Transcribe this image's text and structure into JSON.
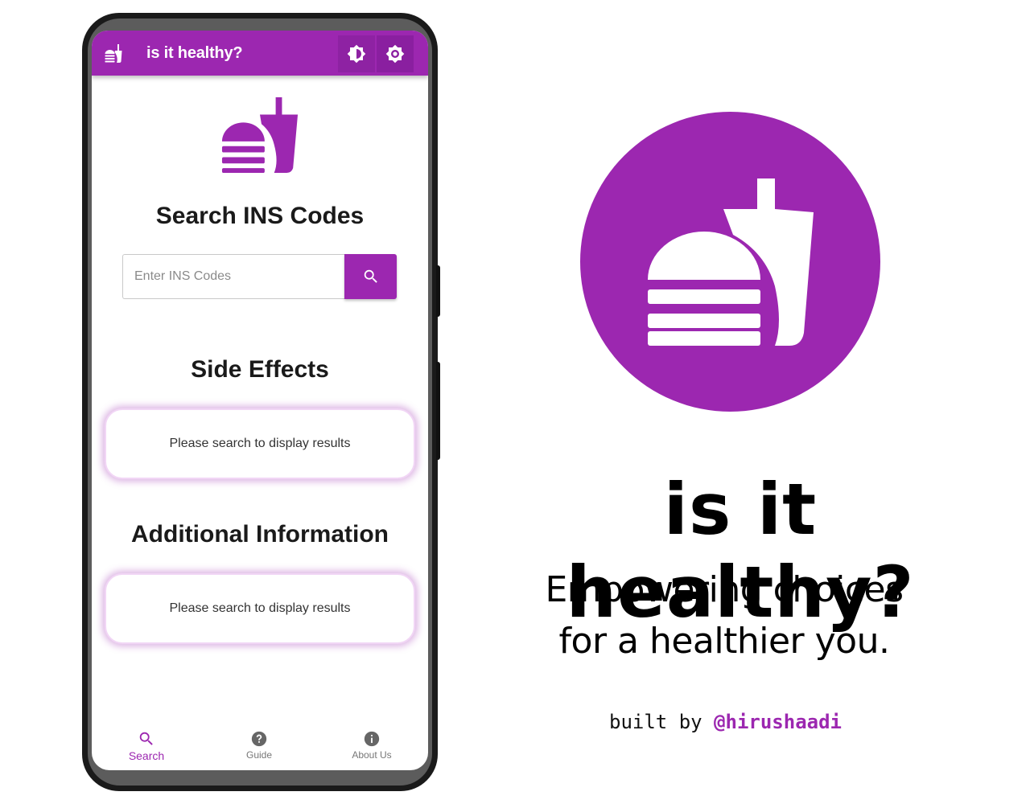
{
  "app": {
    "title": "is it healthy?"
  },
  "appbar": {
    "icons": [
      "app-logo-icon",
      "brightness-icon",
      "settings-icon"
    ]
  },
  "search_section": {
    "heading": "Search INS Codes",
    "input_placeholder": "Enter INS Codes",
    "input_value": "",
    "button_icon": "search-icon"
  },
  "side_effects": {
    "heading": "Side Effects",
    "message": "Please search to display results"
  },
  "additional_info": {
    "heading": "Additional Information",
    "message": "Please search to display results"
  },
  "bottom_nav": {
    "items": [
      {
        "label": "Search",
        "icon": "search-icon",
        "active": true
      },
      {
        "label": "Guide",
        "icon": "help-icon",
        "active": false
      },
      {
        "label": "About Us",
        "icon": "info-icon",
        "active": false
      }
    ]
  },
  "promo": {
    "title": "is it healthy?",
    "tagline_line1": "Empowering choices",
    "tagline_line2": "for a healthier you.",
    "credit_prefix": "built by ",
    "credit_handle": "@hirushaadi"
  },
  "colors": {
    "accent": "#9c27b0",
    "background": "#ffffff",
    "text": "#111111"
  }
}
